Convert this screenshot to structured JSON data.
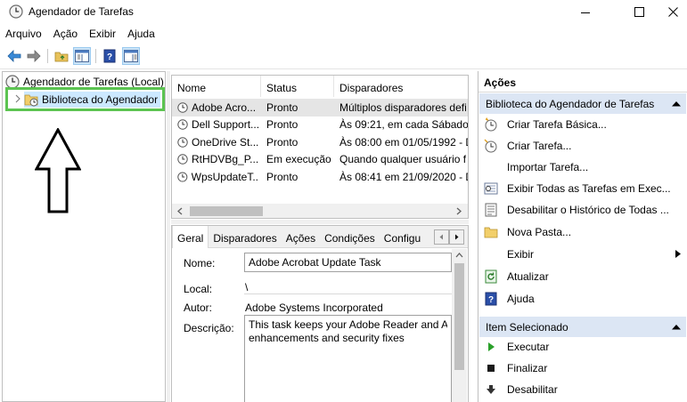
{
  "window": {
    "title": "Agendador de Tarefas"
  },
  "menu": [
    "Arquivo",
    "Ação",
    "Exibir",
    "Ajuda"
  ],
  "tree": {
    "root_label": "Agendador de Tarefas (Local)",
    "child_label": "Biblioteca do Agendador"
  },
  "task_list": {
    "columns": [
      "Nome",
      "Status",
      "Disparadores"
    ],
    "rows": [
      {
        "name": "Adobe Acro...",
        "status": "Pronto",
        "trigger": "Múltiplos disparadores defi"
      },
      {
        "name": "Dell Support...",
        "status": "Pronto",
        "trigger": "Às 09:21, em cada Sábado d"
      },
      {
        "name": "OneDrive St...",
        "status": "Pronto",
        "trigger": "Às 08:00 em 01/05/1992 - D"
      },
      {
        "name": "RtHDVBg_P...",
        "status": "Em execução",
        "trigger": "Quando qualquer usuário f"
      },
      {
        "name": "WpsUpdateT...",
        "status": "Pronto",
        "trigger": "Às 08:41 em 21/09/2020 - D"
      }
    ]
  },
  "details": {
    "tabs": [
      "Geral",
      "Disparadores",
      "Ações",
      "Condições",
      "Configu"
    ],
    "name_label": "Nome:",
    "name_value": "Adobe Acrobat Update Task",
    "location_label": "Local:",
    "location_value": "\\",
    "author_label": "Autor:",
    "author_value": "Adobe Systems Incorporated",
    "description_label": "Descrição:",
    "description_value": "This task keeps your Adobe Reader and Acrobat applications up to date with the latest enhancements and security fixes",
    "description_line1": "This task keeps your Adobe Reader and Acr",
    "description_line2": "enhancements and security fixes"
  },
  "actions": {
    "title": "Ações",
    "section1": "Biblioteca do Agendador de Tarefas",
    "section1_items": [
      {
        "label": "Criar Tarefa Básica...",
        "icon": "create-basic-task-icon"
      },
      {
        "label": "Criar Tarefa...",
        "icon": "create-task-icon"
      },
      {
        "label": "Importar Tarefa...",
        "icon": "none"
      },
      {
        "label": "Exibir Todas as Tarefas em Exec...",
        "icon": "running-tasks-icon"
      },
      {
        "label": "Desabilitar o Histórico de Todas ...",
        "icon": "history-icon"
      },
      {
        "label": "Nova Pasta...",
        "icon": "folder-icon"
      },
      {
        "label": "Exibir",
        "icon": "none"
      },
      {
        "label": "Atualizar",
        "icon": "refresh-icon"
      },
      {
        "label": "Ajuda",
        "icon": "help-icon"
      }
    ],
    "section2": "Item Selecionado",
    "section2_items": [
      {
        "label": "Executar",
        "icon": "run-icon"
      },
      {
        "label": "Finalizar",
        "icon": "stop-icon"
      },
      {
        "label": "Desabilitar",
        "icon": "disable-icon"
      }
    ]
  },
  "colors": {
    "highlight_border": "#5cc451",
    "selection": "#cce8ff",
    "section_header": "#dce6f4"
  }
}
